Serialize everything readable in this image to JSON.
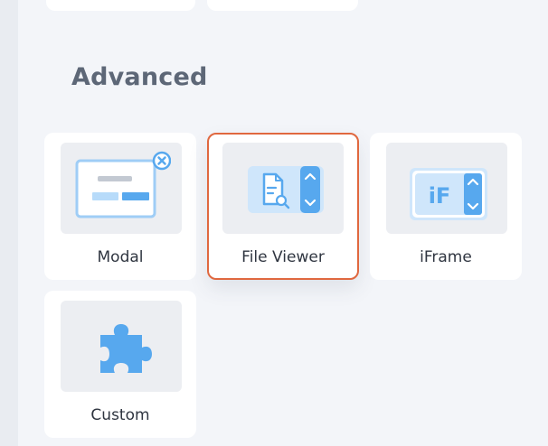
{
  "section": {
    "title": "Advanced"
  },
  "tiles": [
    {
      "label": "Modal",
      "icon": "modal-icon"
    },
    {
      "label": "File Viewer",
      "icon": "file-viewer-icon",
      "selected": true
    },
    {
      "label": "iFrame",
      "icon": "iframe-icon",
      "icon_text": "iF"
    },
    {
      "label": "Custom",
      "icon": "puzzle-icon"
    }
  ],
  "colors": {
    "background": "#f3f5f9",
    "tile": "#ffffff",
    "thumb": "#eceef2",
    "accent_blue": "#57a8ee",
    "light_blue": "#cfe6fb",
    "selected_border": "#e0683f",
    "title": "#5d6777"
  }
}
